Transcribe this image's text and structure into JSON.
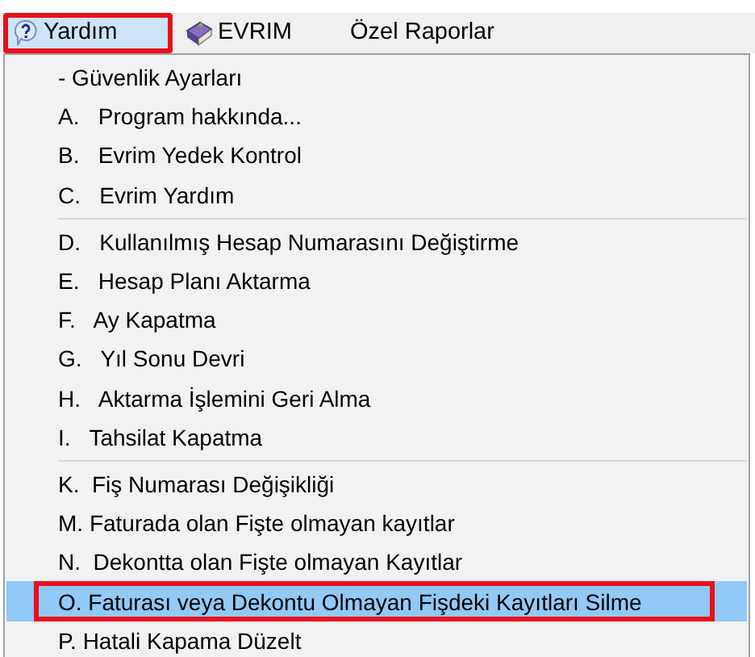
{
  "menu_bar": [
    {
      "label": "Yardım",
      "kind": "help",
      "selected": true,
      "annotated": true
    },
    {
      "label": "EVRIM",
      "kind": "book",
      "selected": false,
      "annotated": false
    },
    {
      "label": "Özel Raporlar",
      "kind": "text",
      "selected": false,
      "annotated": false
    }
  ],
  "menu": {
    "items": [
      {
        "kind": "item",
        "label": "- Güvenlik Ayarları",
        "selected": false,
        "annotated": false
      },
      {
        "kind": "item",
        "label": "A.   Program hakkında...",
        "selected": false,
        "annotated": false
      },
      {
        "kind": "item",
        "label": "B.   Evrim Yedek Kontrol",
        "selected": false,
        "annotated": false
      },
      {
        "kind": "item",
        "label": "C.   Evrim Yardım",
        "selected": false,
        "annotated": false
      },
      {
        "kind": "separator"
      },
      {
        "kind": "item",
        "label": "D.   Kullanılmış Hesap Numarasını Değiştirme",
        "selected": false,
        "annotated": false
      },
      {
        "kind": "item",
        "label": "E.   Hesap Planı Aktarma",
        "selected": false,
        "annotated": false
      },
      {
        "kind": "item",
        "label": "F.   Ay Kapatma",
        "selected": false,
        "annotated": false
      },
      {
        "kind": "item",
        "label": "G.   Yıl Sonu Devri",
        "selected": false,
        "annotated": false
      },
      {
        "kind": "item",
        "label": "H.   Aktarma İşlemini Geri Alma",
        "selected": false,
        "annotated": false
      },
      {
        "kind": "item",
        "label": "I.   Tahsilat Kapatma",
        "selected": false,
        "annotated": false
      },
      {
        "kind": "separator"
      },
      {
        "kind": "item",
        "label": "K.  Fiş Numarası Değişikliği",
        "selected": false,
        "annotated": false
      },
      {
        "kind": "item",
        "label": "M. Faturada olan Fişte olmayan kayıtlar",
        "selected": false,
        "annotated": false
      },
      {
        "kind": "item",
        "label": "N.  Dekontta olan Fişte olmayan Kayıtlar",
        "selected": false,
        "annotated": false
      },
      {
        "kind": "item",
        "label": "O. Faturası veya Dekontu Olmayan Fişdeki Kayıtları Silme",
        "selected": true,
        "annotated": true
      },
      {
        "kind": "item",
        "label": "P. Hatali Kapama Düzelt",
        "selected": false,
        "annotated": false
      }
    ]
  }
}
